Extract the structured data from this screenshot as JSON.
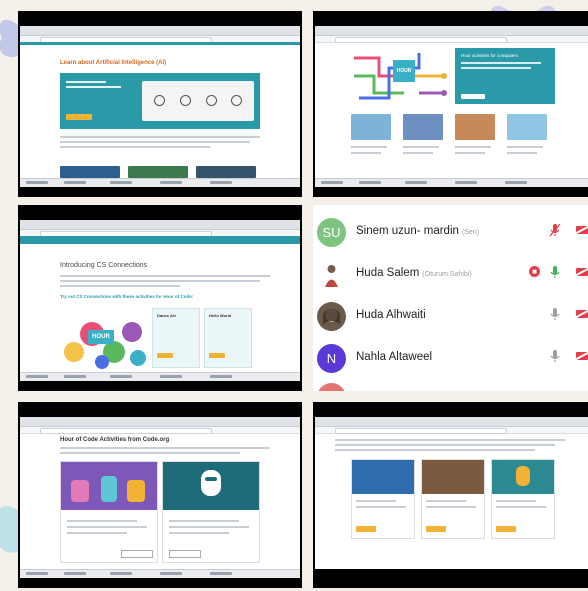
{
  "tiles": {
    "ai": {
      "heading": "Learn about Artificial Intelligence (AI)"
    },
    "cs": {
      "heading": "Introducing CS Connections",
      "link_text": "Try out CS Connections with these activities for Hour of Code:",
      "card1_title": "Dance Art",
      "card2_title": "Hello World",
      "logo_text": "HOUR"
    },
    "hour_map": {
      "logo_text": "HOUR",
      "card_title": "Hour activities for computers"
    },
    "hoc": {
      "heading": "Hour of Code Activities from Code.org"
    },
    "ai_course": {}
  },
  "participants": [
    {
      "initials": "SU",
      "name": "Sinem uzun- mardin",
      "role": "(Sen)",
      "avatar_color": "#7cc47f",
      "mic": "muted",
      "cam_off": true
    },
    {
      "initials": "",
      "name": "Huda Salem",
      "role": "(Oturum Sahibi)",
      "avatar_color": "#ffffff",
      "mic": "on",
      "share_stop": true,
      "cam_off": true
    },
    {
      "initials": "",
      "name": "Huda Alhwaiti",
      "role": "",
      "avatar_color": "#6b5a4a",
      "mic": "off",
      "cam_off": true
    },
    {
      "initials": "N",
      "name": "Nahla Altaweel",
      "role": "",
      "avatar_color": "#5b39d6",
      "mic": "off",
      "cam_off": true
    },
    {
      "initials": "",
      "name": "",
      "role": "",
      "avatar_color": "#e57373",
      "mic": "off",
      "cam_off": true
    }
  ],
  "colors": {
    "teal": "#2a9aa8",
    "accent_yellow": "#f2b233",
    "cam_off_red": "#e23d4b",
    "mic_on_green": "#3fb25a"
  }
}
